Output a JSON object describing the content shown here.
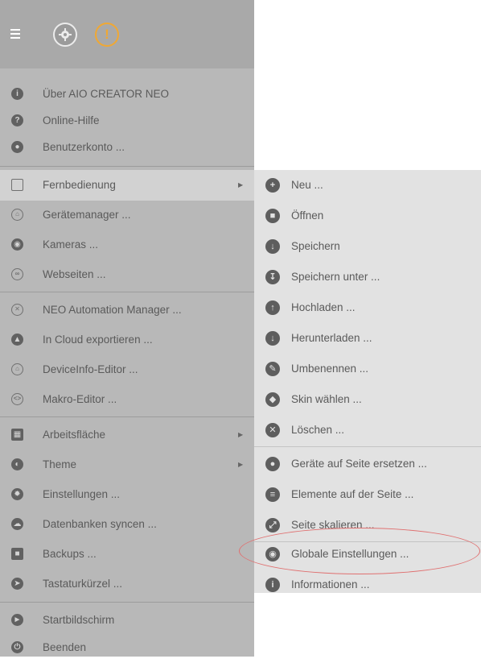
{
  "main_menu": {
    "items": [
      {
        "label": "Über AIO CREATOR NEO",
        "icon": "info-icon"
      },
      {
        "label": "Online-Hilfe",
        "icon": "question-icon"
      },
      {
        "label": "Benutzerkonto ...",
        "icon": "user-icon"
      },
      {
        "label": "Fernbedienung",
        "icon": "phone-icon"
      },
      {
        "label": "Gerätemanager ...",
        "icon": "home-icon"
      },
      {
        "label": "Kameras ...",
        "icon": "camera-icon"
      },
      {
        "label": "Webseiten ...",
        "icon": "link-icon"
      },
      {
        "label": "NEO Automation Manager ...",
        "icon": "automation-icon"
      },
      {
        "label": "In Cloud exportieren ...",
        "icon": "cloud-upload-icon"
      },
      {
        "label": "DeviceInfo-Editor ...",
        "icon": "device-info-icon"
      },
      {
        "label": "Makro-Editor ...",
        "icon": "code-icon"
      },
      {
        "label": "Arbeitsfläche",
        "icon": "grid-icon"
      },
      {
        "label": "Theme",
        "icon": "contrast-icon"
      },
      {
        "label": "Einstellungen ...",
        "icon": "gear-icon"
      },
      {
        "label": "Datenbanken syncen ...",
        "icon": "cloud-icon"
      },
      {
        "label": "Backups ...",
        "icon": "folder-icon"
      },
      {
        "label": "Tastaturkürzel ...",
        "icon": "rocket-icon"
      },
      {
        "label": "Startbildschirm",
        "icon": "start-icon"
      },
      {
        "label": "Beenden",
        "icon": "power-icon"
      }
    ]
  },
  "sub_menu": {
    "items": [
      {
        "label": "Neu ...",
        "icon": "plus-icon"
      },
      {
        "label": "Öffnen",
        "icon": "folder-icon"
      },
      {
        "label": "Speichern",
        "icon": "download-icon"
      },
      {
        "label": "Speichern unter ...",
        "icon": "save-as-icon"
      },
      {
        "label": "Hochladen ...",
        "icon": "upload-icon"
      },
      {
        "label": "Herunterladen ...",
        "icon": "download-icon"
      },
      {
        "label": "Umbenennen ...",
        "icon": "pencil-icon"
      },
      {
        "label": "Skin wählen ...",
        "icon": "skin-icon"
      },
      {
        "label": "Löschen ...",
        "icon": "close-icon"
      },
      {
        "label": "Geräte auf Seite ersetzen ...",
        "icon": "replace-icon"
      },
      {
        "label": "Elemente auf der Seite ...",
        "icon": "list-icon"
      },
      {
        "label": "Seite skalieren ...",
        "icon": "resize-icon"
      },
      {
        "label": "Globale Einstellungen ...",
        "icon": "gear-icon"
      },
      {
        "label": "Informationen ...",
        "icon": "info-icon"
      }
    ]
  },
  "colors": {
    "menu_bg": "#b8b8b8",
    "header_bg": "#a9a9a9",
    "submenu_bg": "#e2e2e2",
    "active_bg": "#d2d2d2",
    "warning": "#f0a833",
    "highlight_ring": "#e07070"
  }
}
